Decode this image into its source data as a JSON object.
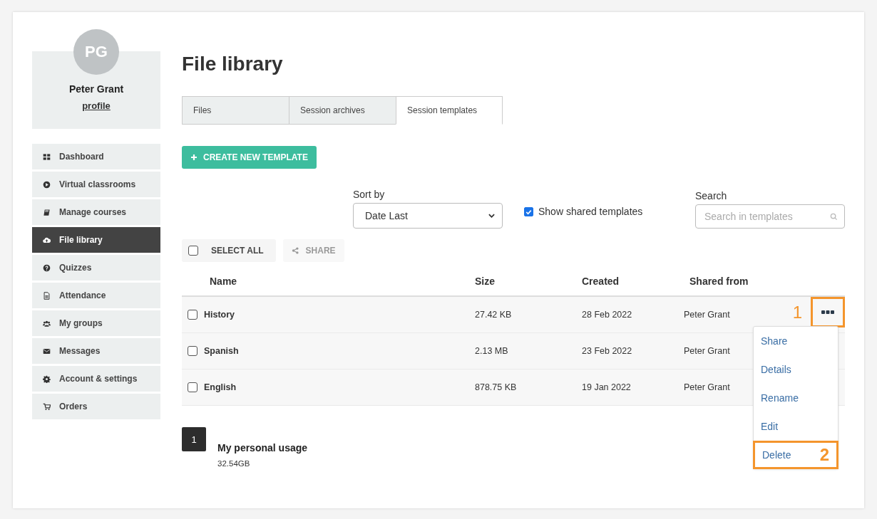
{
  "profile": {
    "initials": "PG",
    "name": "Peter Grant",
    "link": "profile"
  },
  "nav": [
    {
      "label": "Dashboard",
      "selected": false
    },
    {
      "label": "Virtual classrooms",
      "selected": false
    },
    {
      "label": "Manage courses",
      "selected": false
    },
    {
      "label": "File library",
      "selected": true
    },
    {
      "label": "Quizzes",
      "selected": false
    },
    {
      "label": "Attendance",
      "selected": false
    },
    {
      "label": "My groups",
      "selected": false
    },
    {
      "label": "Messages",
      "selected": false
    },
    {
      "label": "Account & settings",
      "selected": false
    },
    {
      "label": "Orders",
      "selected": false
    }
  ],
  "title": "File library",
  "tabs": [
    {
      "label": "Files",
      "selected": false
    },
    {
      "label": "Session archives",
      "selected": false
    },
    {
      "label": "Session templates",
      "selected": true
    }
  ],
  "create_button": "CREATE NEW TEMPLATE",
  "sort": {
    "label": "Sort by",
    "value": "Date Last"
  },
  "show_shared": {
    "label": "Show shared templates",
    "checked": true
  },
  "search": {
    "label": "Search",
    "placeholder": "Search in templates"
  },
  "select_all": {
    "label": "SELECT ALL",
    "checked": false
  },
  "share_button": {
    "label": "SHARE",
    "disabled": true
  },
  "table": {
    "columns": [
      "Name",
      "Size",
      "Created",
      "Shared from"
    ],
    "rows": [
      {
        "name": "History",
        "size": "27.42 KB",
        "created": "28 Feb 2022",
        "shared_from": "Peter Grant",
        "checked": false
      },
      {
        "name": "Spanish",
        "size": "2.13 MB",
        "created": "23 Feb 2022",
        "shared_from": "Peter Grant",
        "checked": false
      },
      {
        "name": "English",
        "size": "878.75 KB",
        "created": "19 Jan 2022",
        "shared_from": "Peter Grant",
        "checked": false
      }
    ]
  },
  "row_menu": {
    "callout": "1",
    "items": [
      {
        "label": "Share",
        "highlighted": false
      },
      {
        "label": "Details",
        "highlighted": false
      },
      {
        "label": "Rename",
        "highlighted": false
      },
      {
        "label": "Edit",
        "highlighted": false
      },
      {
        "label": "Delete",
        "highlighted": true,
        "callout": "2"
      }
    ]
  },
  "pagination": [
    {
      "label": "1",
      "selected": true
    }
  ],
  "usage": {
    "title": "My personal usage",
    "amount": "32.54GB"
  }
}
